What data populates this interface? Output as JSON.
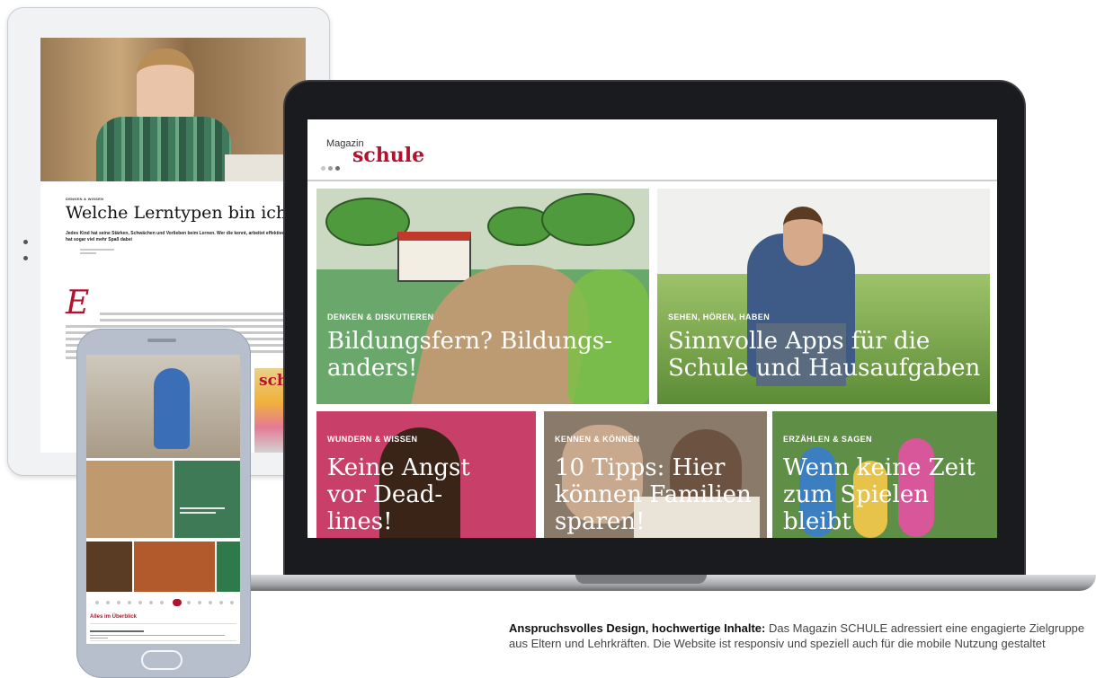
{
  "tablet": {
    "kicker": "DENKEN & WISSEN",
    "title": "Welche Lerntypen bin ich?",
    "lead": "Jedes Kind hat seine Stärken, Schwächen und Vorlieben beim Lernen. Wer die kennt, arbeitet effektiver - und hat sogar viel mehr Spaß dabei",
    "dropcap": "E",
    "promo_word": "schu"
  },
  "laptop": {
    "logo_small": "Magazin",
    "logo_big": "schule",
    "tiles": [
      {
        "label": "DENKEN & DISKUTIEREN",
        "title": "Bildungsfern? Bildungs-anders!"
      },
      {
        "label": "SEHEN, HÖREN, HABEN",
        "title": "Sinnvolle Apps für die Schule und Hausaufgaben"
      },
      {
        "label": "WUNDERN & WISSEN",
        "title": "Keine Angst vor Dead-lines!"
      },
      {
        "label": "KENNEN & KÖNNEN",
        "title": "10 Tipps: Hier können Familien sparen!"
      },
      {
        "label": "ERZÄHLEN & SAGEN",
        "title": "Wenn keine Zeit zum Spielen bleibt"
      }
    ]
  },
  "phone": {
    "overview": "Alles im Überblick"
  },
  "caption": {
    "bold": "Anspruchsvolles Design, hochwertige Inhalte:",
    "text": " Das Magazin SCHULE adressiert eine engagierte Zielgruppe aus Eltern und Lehrkräften. Die Website ist responsiv und speziell auch für die mobile Nutzung gestaltet"
  },
  "colors": {
    "brand_red": "#b3122e",
    "laptop_bezel": "#1a1b1e",
    "phone_body": "#b7bfcc"
  }
}
